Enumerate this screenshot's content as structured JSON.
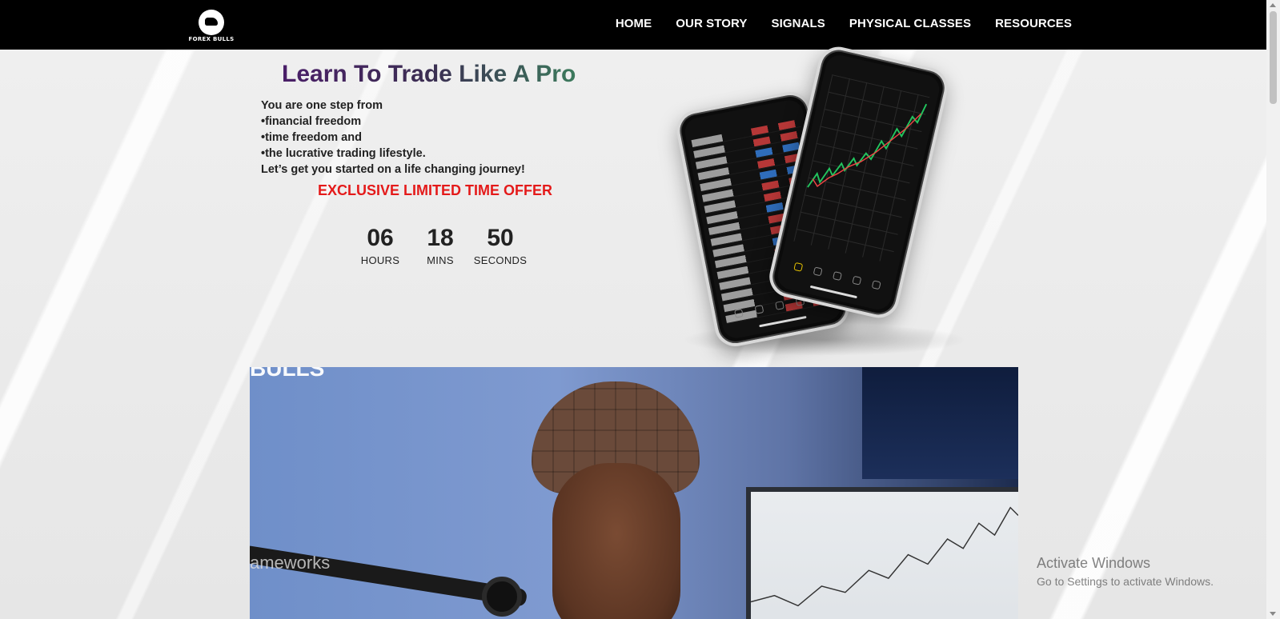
{
  "brand": {
    "logo_text": "FOREX BULLS",
    "icon": "bull-logo-icon"
  },
  "nav": {
    "items": [
      {
        "label": "HOME"
      },
      {
        "label": "OUR STORY"
      },
      {
        "label": "SIGNALS"
      },
      {
        "label": "PHYSICAL CLASSES"
      },
      {
        "label": "RESOURCES"
      }
    ]
  },
  "hero": {
    "title": "Learn To Trade Like A Pro",
    "lines": [
      "You are one step from",
      "•financial freedom",
      "•time freedom and",
      "•the lucrative trading lifestyle.",
      "Let’s get you started on a life changing journey!"
    ],
    "offer": "EXCLUSIVE LIMITED TIME OFFER",
    "countdown": {
      "hours": "06",
      "hours_label": "HOURS",
      "mins": "18",
      "mins_label": "MINS",
      "seconds": "50",
      "seconds_label": "SECONDS"
    }
  },
  "video": {
    "sign_text": "BULLS",
    "mic_brand_text": "ameworks"
  },
  "watermark": {
    "title": "Activate Windows",
    "subtitle": "Go to Settings to activate Windows."
  },
  "colors": {
    "nav_bg": "#000000",
    "offer_red": "#e41a1a",
    "title_purple": "#4a1f68",
    "title_green": "#3c7a5c"
  }
}
